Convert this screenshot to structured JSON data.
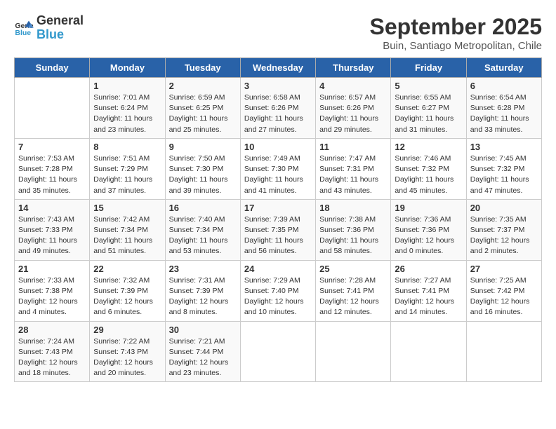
{
  "header": {
    "logo_general": "General",
    "logo_blue": "Blue",
    "month_title": "September 2025",
    "location": "Buin, Santiago Metropolitan, Chile"
  },
  "days_of_week": [
    "Sunday",
    "Monday",
    "Tuesday",
    "Wednesday",
    "Thursday",
    "Friday",
    "Saturday"
  ],
  "weeks": [
    [
      {
        "day": "",
        "info": ""
      },
      {
        "day": "1",
        "info": "Sunrise: 7:01 AM\nSunset: 6:24 PM\nDaylight: 11 hours\nand 23 minutes."
      },
      {
        "day": "2",
        "info": "Sunrise: 6:59 AM\nSunset: 6:25 PM\nDaylight: 11 hours\nand 25 minutes."
      },
      {
        "day": "3",
        "info": "Sunrise: 6:58 AM\nSunset: 6:26 PM\nDaylight: 11 hours\nand 27 minutes."
      },
      {
        "day": "4",
        "info": "Sunrise: 6:57 AM\nSunset: 6:26 PM\nDaylight: 11 hours\nand 29 minutes."
      },
      {
        "day": "5",
        "info": "Sunrise: 6:55 AM\nSunset: 6:27 PM\nDaylight: 11 hours\nand 31 minutes."
      },
      {
        "day": "6",
        "info": "Sunrise: 6:54 AM\nSunset: 6:28 PM\nDaylight: 11 hours\nand 33 minutes."
      }
    ],
    [
      {
        "day": "7",
        "info": "Sunrise: 7:53 AM\nSunset: 7:28 PM\nDaylight: 11 hours\nand 35 minutes."
      },
      {
        "day": "8",
        "info": "Sunrise: 7:51 AM\nSunset: 7:29 PM\nDaylight: 11 hours\nand 37 minutes."
      },
      {
        "day": "9",
        "info": "Sunrise: 7:50 AM\nSunset: 7:30 PM\nDaylight: 11 hours\nand 39 minutes."
      },
      {
        "day": "10",
        "info": "Sunrise: 7:49 AM\nSunset: 7:30 PM\nDaylight: 11 hours\nand 41 minutes."
      },
      {
        "day": "11",
        "info": "Sunrise: 7:47 AM\nSunset: 7:31 PM\nDaylight: 11 hours\nand 43 minutes."
      },
      {
        "day": "12",
        "info": "Sunrise: 7:46 AM\nSunset: 7:32 PM\nDaylight: 11 hours\nand 45 minutes."
      },
      {
        "day": "13",
        "info": "Sunrise: 7:45 AM\nSunset: 7:32 PM\nDaylight: 11 hours\nand 47 minutes."
      }
    ],
    [
      {
        "day": "14",
        "info": "Sunrise: 7:43 AM\nSunset: 7:33 PM\nDaylight: 11 hours\nand 49 minutes."
      },
      {
        "day": "15",
        "info": "Sunrise: 7:42 AM\nSunset: 7:34 PM\nDaylight: 11 hours\nand 51 minutes."
      },
      {
        "day": "16",
        "info": "Sunrise: 7:40 AM\nSunset: 7:34 PM\nDaylight: 11 hours\nand 53 minutes."
      },
      {
        "day": "17",
        "info": "Sunrise: 7:39 AM\nSunset: 7:35 PM\nDaylight: 11 hours\nand 56 minutes."
      },
      {
        "day": "18",
        "info": "Sunrise: 7:38 AM\nSunset: 7:36 PM\nDaylight: 11 hours\nand 58 minutes."
      },
      {
        "day": "19",
        "info": "Sunrise: 7:36 AM\nSunset: 7:36 PM\nDaylight: 12 hours\nand 0 minutes."
      },
      {
        "day": "20",
        "info": "Sunrise: 7:35 AM\nSunset: 7:37 PM\nDaylight: 12 hours\nand 2 minutes."
      }
    ],
    [
      {
        "day": "21",
        "info": "Sunrise: 7:33 AM\nSunset: 7:38 PM\nDaylight: 12 hours\nand 4 minutes."
      },
      {
        "day": "22",
        "info": "Sunrise: 7:32 AM\nSunset: 7:39 PM\nDaylight: 12 hours\nand 6 minutes."
      },
      {
        "day": "23",
        "info": "Sunrise: 7:31 AM\nSunset: 7:39 PM\nDaylight: 12 hours\nand 8 minutes."
      },
      {
        "day": "24",
        "info": "Sunrise: 7:29 AM\nSunset: 7:40 PM\nDaylight: 12 hours\nand 10 minutes."
      },
      {
        "day": "25",
        "info": "Sunrise: 7:28 AM\nSunset: 7:41 PM\nDaylight: 12 hours\nand 12 minutes."
      },
      {
        "day": "26",
        "info": "Sunrise: 7:27 AM\nSunset: 7:41 PM\nDaylight: 12 hours\nand 14 minutes."
      },
      {
        "day": "27",
        "info": "Sunrise: 7:25 AM\nSunset: 7:42 PM\nDaylight: 12 hours\nand 16 minutes."
      }
    ],
    [
      {
        "day": "28",
        "info": "Sunrise: 7:24 AM\nSunset: 7:43 PM\nDaylight: 12 hours\nand 18 minutes."
      },
      {
        "day": "29",
        "info": "Sunrise: 7:22 AM\nSunset: 7:43 PM\nDaylight: 12 hours\nand 20 minutes."
      },
      {
        "day": "30",
        "info": "Sunrise: 7:21 AM\nSunset: 7:44 PM\nDaylight: 12 hours\nand 23 minutes."
      },
      {
        "day": "",
        "info": ""
      },
      {
        "day": "",
        "info": ""
      },
      {
        "day": "",
        "info": ""
      },
      {
        "day": "",
        "info": ""
      }
    ]
  ]
}
